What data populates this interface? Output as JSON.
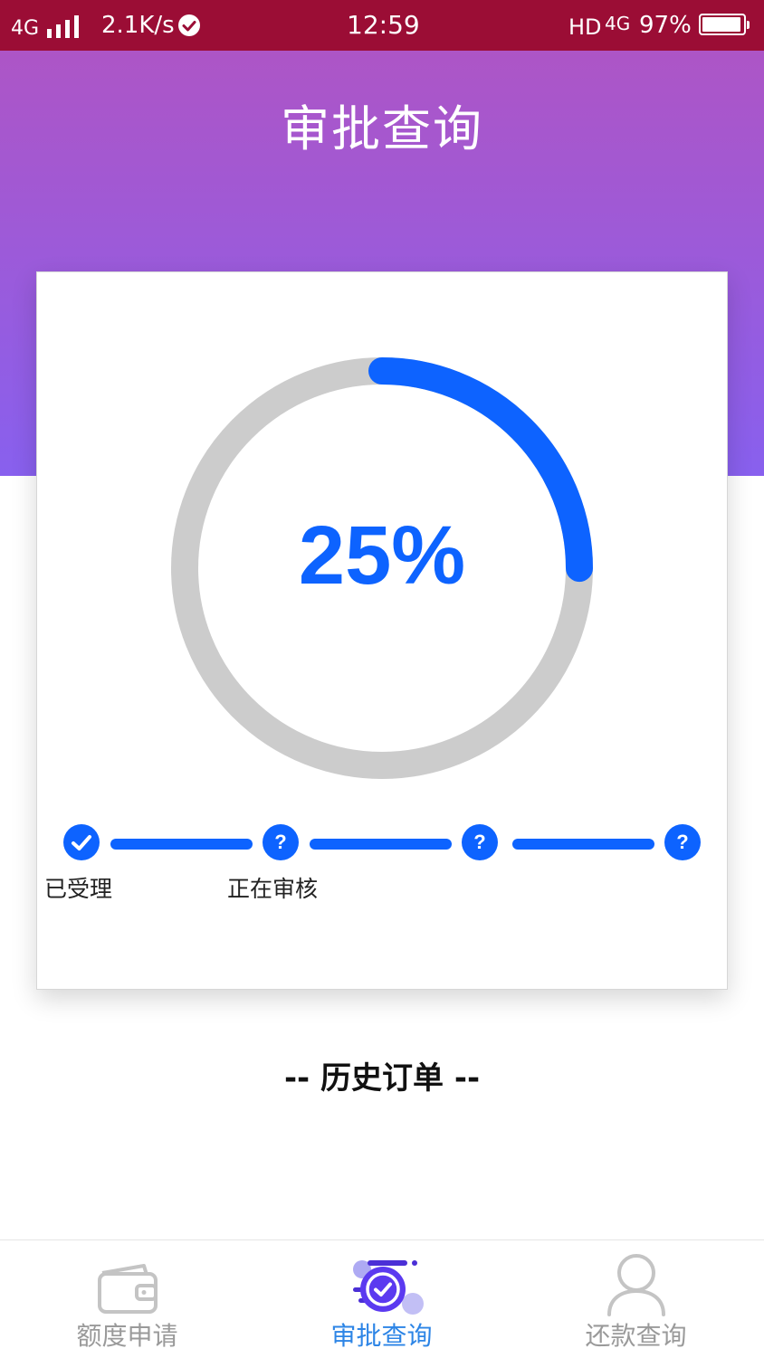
{
  "status_bar": {
    "network": "4G",
    "speed": "2.1K/s",
    "time": "12:59",
    "hd": "HD",
    "network_right": "4G",
    "battery": "97%"
  },
  "header": {
    "title": "审批查询"
  },
  "progress": {
    "value": 0.25,
    "label": "25%",
    "track_color": "#cccccc",
    "fill_color": "#0d63ff"
  },
  "steps": [
    {
      "label": "已受理",
      "state": "done",
      "icon": "check-icon"
    },
    {
      "label": "正在审核",
      "state": "pending",
      "icon": "?"
    },
    {
      "label": "",
      "state": "pending",
      "icon": "?"
    },
    {
      "label": "",
      "state": "pending",
      "icon": "?"
    }
  ],
  "history": {
    "title": "-- 历史订单 --"
  },
  "bottom_nav": {
    "items": [
      {
        "label": "额度申请",
        "icon": "wallet-icon",
        "active": false
      },
      {
        "label": "审批查询",
        "icon": "approval-check-icon",
        "active": true
      },
      {
        "label": "还款查询",
        "icon": "user-icon",
        "active": false
      }
    ]
  },
  "colors": {
    "status_bar": "#9b0d35",
    "header_gradient_top": "#ad55c6",
    "header_gradient_bottom": "#8860ee",
    "accent_blue": "#0d63ff",
    "nav_active": "#2d85e6",
    "nav_inactive": "#9a9a9a"
  }
}
